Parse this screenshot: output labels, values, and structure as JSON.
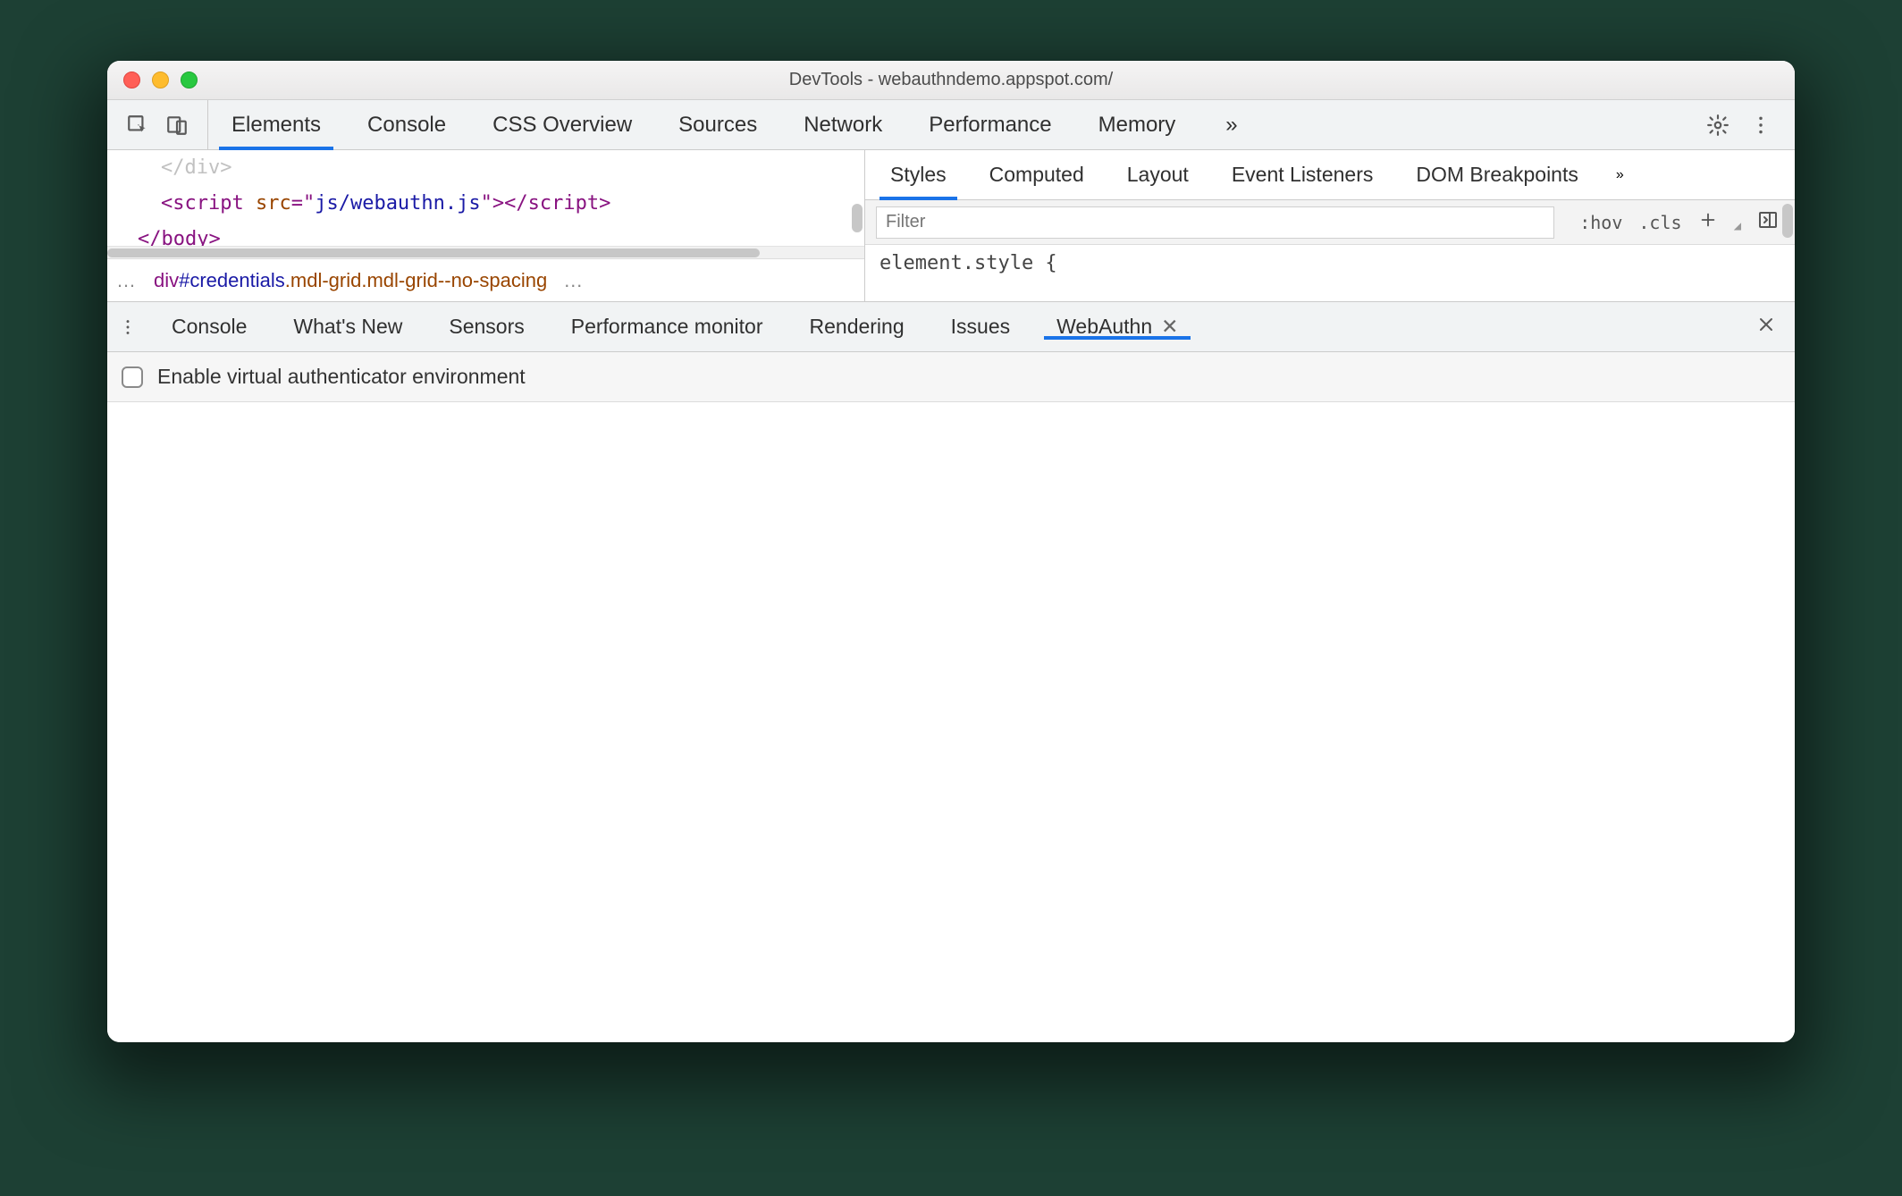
{
  "window": {
    "title": "DevTools - webauthndemo.appspot.com/"
  },
  "mainTabs": {
    "items": [
      "Elements",
      "Console",
      "CSS Overview",
      "Sources",
      "Network",
      "Performance",
      "Memory"
    ],
    "active": 0,
    "overflow": "»"
  },
  "code": {
    "line1_tag_close": "</div>",
    "line2_open": "<script ",
    "line2_attr": "src",
    "line2_eq": "=\"",
    "line2_val": "js/webauthn.js",
    "line2_close": "\"></scr",
    "line2_close2": "ipt>",
    "line3": "</body>"
  },
  "crumb": {
    "part1": "div",
    "part2": "#credentials",
    "part3": ".mdl-grid.mdl-grid--no-spacing"
  },
  "subTabs": {
    "items": [
      "Styles",
      "Computed",
      "Layout",
      "Event Listeners",
      "DOM Breakpoints"
    ],
    "active": 0,
    "overflow": "»"
  },
  "filter": {
    "placeholder": "Filter",
    "hov": ":hov",
    "cls": ".cls"
  },
  "styleBody": "element.style {",
  "drawerTabs": {
    "items": [
      "Console",
      "What's New",
      "Sensors",
      "Performance monitor",
      "Rendering",
      "Issues",
      "WebAuthn"
    ],
    "active": 6
  },
  "webauthn": {
    "checkbox_label": "Enable virtual authenticator environment"
  }
}
